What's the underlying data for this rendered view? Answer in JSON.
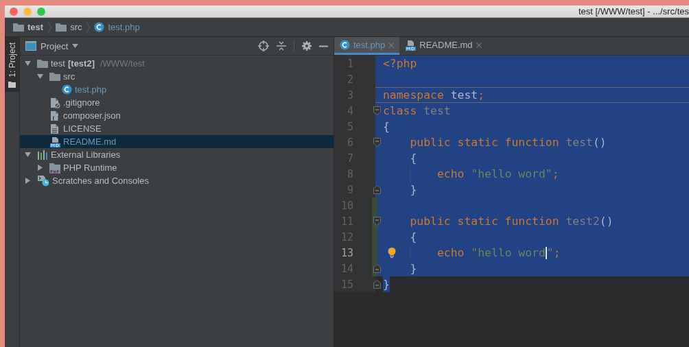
{
  "window": {
    "title": "test [/WWW/test] - .../src/tes"
  },
  "breadcrumbs": [
    {
      "label": "test",
      "kind": "folder"
    },
    {
      "label": "src",
      "kind": "folder"
    },
    {
      "label": "test.php",
      "kind": "class"
    }
  ],
  "tool_strip": {
    "label": "1: Project"
  },
  "project_panel": {
    "title": "Project",
    "tree": [
      {
        "label": "test",
        "kind": "folder",
        "expanded": true,
        "selected": false,
        "color": "#bbbbbb",
        "module": "[test2]",
        "path": "/WWW/test",
        "children": [
          {
            "label": "src",
            "kind": "folder",
            "expanded": true,
            "selected": false,
            "color": "#bbbbbb",
            "children": [
              {
                "label": "test.php",
                "kind": "class",
                "selected": false,
                "color": "#6897bb"
              }
            ]
          },
          {
            "label": ".gitignore",
            "kind": "ignore",
            "selected": false,
            "color": "#bbbbbb"
          },
          {
            "label": "composer.json",
            "kind": "json",
            "selected": false,
            "color": "#bbbbbb"
          },
          {
            "label": "LICENSE",
            "kind": "text",
            "selected": false,
            "color": "#bbbbbb"
          },
          {
            "label": "README.md",
            "kind": "markdown",
            "selected": true,
            "color": "#6897bb"
          }
        ]
      },
      {
        "label": "External Libraries",
        "kind": "libraries",
        "expanded": true,
        "selected": false,
        "color": "#bbbbbb",
        "children": [
          {
            "label": "PHP Runtime",
            "kind": "php-folder",
            "expanded": false,
            "selected": false,
            "color": "#bbbbbb"
          }
        ]
      },
      {
        "label": "Scratches and Consoles",
        "kind": "scratches",
        "expanded": false,
        "selected": false,
        "color": "#bbbbbb"
      }
    ]
  },
  "editor": {
    "tabs": [
      {
        "label": "test.php",
        "kind": "class",
        "selected": true,
        "color": "#6897bb"
      },
      {
        "label": "README.md",
        "kind": "markdown",
        "selected": false,
        "color": "#a9b7c6"
      }
    ],
    "lines": [
      {
        "number": "1",
        "selected": true,
        "changed": false,
        "kind": "top",
        "tokens": [
          {
            "kind": "keyword",
            "text": "<?php"
          }
        ]
      },
      {
        "number": "2",
        "selected": true,
        "changed": false,
        "kind": "top"
      },
      {
        "number": "3",
        "selected": true,
        "changed": false,
        "kind": "top",
        "separator": true,
        "tokens": [
          {
            "kind": "keyword",
            "text": "namespace"
          },
          {
            "kind": "plain",
            "text": " test"
          },
          {
            "kind": "keyword",
            "text": ";"
          }
        ]
      },
      {
        "number": "4",
        "selected": true,
        "changed": false,
        "kind": "top",
        "fold_open": true,
        "tokens": [
          {
            "kind": "keyword",
            "text": "class"
          },
          {
            "kind": "ident",
            "text": " test"
          }
        ]
      },
      {
        "number": "5",
        "selected": true,
        "changed": false,
        "kind": "top",
        "tokens": [
          {
            "kind": "plain",
            "text": "{"
          }
        ]
      },
      {
        "number": "6",
        "selected": true,
        "changed": false,
        "kind": "class",
        "fold_open": true,
        "tokens": [
          {
            "kind": "keyword",
            "text": "public static function"
          },
          {
            "kind": "ident",
            "text": " test"
          },
          {
            "kind": "plain",
            "text": "()"
          }
        ]
      },
      {
        "number": "7",
        "selected": true,
        "changed": false,
        "kind": "class",
        "tokens": [
          {
            "kind": "plain",
            "text": "{"
          }
        ]
      },
      {
        "number": "8",
        "selected": true,
        "changed": false,
        "kind": "method",
        "tokens": [
          {
            "kind": "keyword",
            "text": "echo"
          },
          {
            "kind": "string",
            "text": " \"hello word\""
          },
          {
            "kind": "keyword",
            "text": ";"
          }
        ]
      },
      {
        "number": "9",
        "selected": true,
        "changed": false,
        "kind": "class",
        "fold_close": true,
        "tokens": [
          {
            "kind": "plain",
            "text": "}"
          }
        ]
      },
      {
        "number": "10",
        "selected": true,
        "changed": true,
        "kind": "top"
      },
      {
        "number": "11",
        "selected": true,
        "changed": true,
        "kind": "class",
        "fold_open": true,
        "tokens": [
          {
            "kind": "keyword",
            "text": "public static function"
          },
          {
            "kind": "ident",
            "text": " test2"
          },
          {
            "kind": "plain",
            "text": "()"
          }
        ]
      },
      {
        "number": "12",
        "selected": true,
        "changed": true,
        "kind": "class",
        "tokens": [
          {
            "kind": "plain",
            "text": "{"
          }
        ]
      },
      {
        "number": "13",
        "selected": true,
        "changed": true,
        "kind": "method",
        "current": true,
        "bulb": true,
        "tokens": [
          {
            "kind": "keyword",
            "text": "echo"
          },
          {
            "kind": "string",
            "text": " \"hello word"
          },
          {
            "kind": "caret"
          },
          {
            "kind": "string",
            "text": "\""
          },
          {
            "kind": "keyword",
            "text": ";"
          }
        ]
      },
      {
        "number": "14",
        "selected": true,
        "changed": true,
        "kind": "class",
        "fold_close": true,
        "tokens": [
          {
            "kind": "plain",
            "text": "}"
          }
        ]
      },
      {
        "number": "15",
        "selected": false,
        "changed": false,
        "kind": "top",
        "fold_close": true,
        "tokens": [
          {
            "kind": "plain",
            "text": "}",
            "selected": true
          }
        ]
      }
    ]
  }
}
